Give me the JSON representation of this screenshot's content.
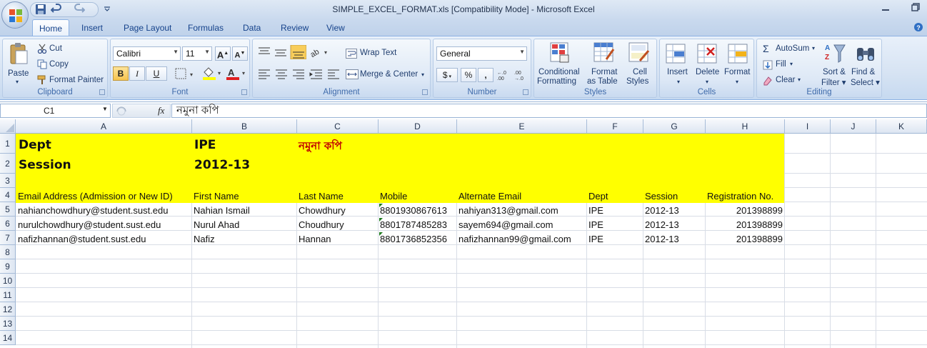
{
  "window": {
    "title": "SIMPLE_EXCEL_FORMAT.xls  [Compatibility Mode] - Microsoft Excel"
  },
  "tabs": [
    "Home",
    "Insert",
    "Page Layout",
    "Formulas",
    "Data",
    "Review",
    "View"
  ],
  "ribbon": {
    "clipboard": {
      "label": "Clipboard",
      "paste": "Paste",
      "cut": "Cut",
      "copy": "Copy",
      "format_painter": "Format Painter"
    },
    "font": {
      "label": "Font",
      "font_name": "Calibri",
      "font_size": "11",
      "bold": "B",
      "italic": "I",
      "underline": "U"
    },
    "alignment": {
      "label": "Alignment",
      "wrap_text": "Wrap Text",
      "merge_center": "Merge & Center"
    },
    "number": {
      "label": "Number",
      "format": "General",
      "currency": "$",
      "percent": "%",
      "comma": ","
    },
    "styles": {
      "label": "Styles",
      "conditional": "Conditional",
      "conditional2": "Formatting",
      "format_as": "Format",
      "format_as2": "as Table",
      "cell": "Cell",
      "cell2": "Styles"
    },
    "cells": {
      "label": "Cells",
      "insert": "Insert",
      "delete": "Delete",
      "format": "Format"
    },
    "editing": {
      "label": "Editing",
      "autosum": "AutoSum",
      "fill": "Fill",
      "clear": "Clear",
      "sort": "Sort &",
      "sort2": "Filter",
      "find": "Find &",
      "find2": "Select"
    }
  },
  "formula_bar": {
    "name_box": "C1",
    "fx": "fx",
    "content": "নমুনা কপি"
  },
  "columns": [
    "A",
    "B",
    "C",
    "D",
    "E",
    "F",
    "G",
    "H",
    "I",
    "J",
    "K"
  ],
  "rows": [
    "1",
    "2",
    "3",
    "4",
    "5",
    "6",
    "7",
    "8",
    "9",
    "10",
    "11",
    "12",
    "13",
    "14"
  ],
  "cells": {
    "A1": "Dept",
    "B1": "IPE",
    "C1": "নমুনা কপি",
    "A2": "Session",
    "B2": "2012-13",
    "headers": [
      "Email Address (Admission or New ID)",
      "First Name",
      "Last Name",
      "Mobile",
      "Alternate Email",
      "Dept",
      "Session",
      "Registration No."
    ],
    "records": [
      [
        "nahianchowdhury@student.sust.edu",
        "Nahian Ismail",
        "Chowdhury",
        "8801930867613",
        "nahiyan313@gmail.com",
        "IPE",
        "2012-13",
        "201398899"
      ],
      [
        "nurulchowdhury@student.sust.edu",
        "Nurul Ahad",
        "Choudhury",
        "8801787485283",
        "sayem694@gmail.com",
        "IPE",
        "2012-13",
        "201398899"
      ],
      [
        "nafizhannan@student.sust.edu",
        "Nafiz",
        "Hannan",
        "8801736852356",
        "nafizhannan99@gmail.com",
        "IPE",
        "2012-13",
        "201398899"
      ]
    ]
  },
  "colors": {
    "highlight": "#ffff00",
    "sample_text": "#c00000"
  }
}
